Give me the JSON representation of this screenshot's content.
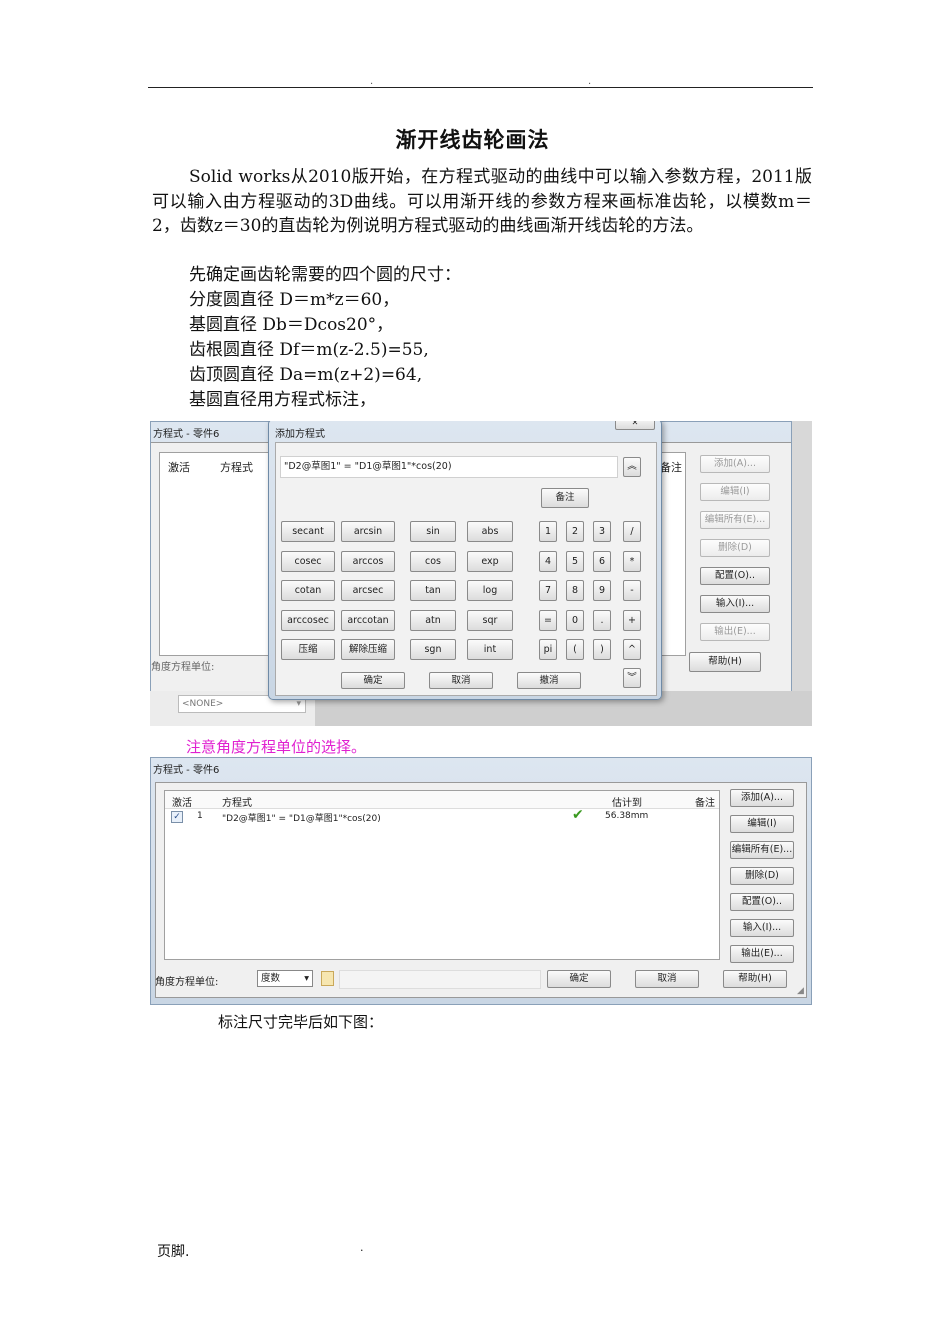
{
  "header": {
    "dot_left": ".",
    "dot_right": "."
  },
  "title": "渐开线齿轮画法",
  "intro": "Solid works从2010版开始，在方程式驱动的曲线中可以输入参数方程，2011版可以输入由方程驱动的3D曲线。可以用渐开线的参数方程来画标准齿轮，以模数m＝2，齿数z＝30的直齿轮为例说明方程式驱动的曲线画渐开线齿轮的方法。",
  "lines": [
    "先确定画齿轮需要的四个圆的尺寸：",
    "分度圆直径 D＝m*z＝60，",
    "基圆直径 Db＝Dcos20°，",
    "齿根圆直径 Df＝m(z-2.5)=55,",
    "齿顶圆直径 Da=m(z+2)=64,",
    "基圆直径用方程式标注，"
  ],
  "screenshot1": {
    "back_window_title": "方程式 - 零件6",
    "back_columns": [
      "激活",
      "方程式",
      "备注"
    ],
    "back_buttons": [
      {
        "label": "添加(A)...",
        "enabled": false
      },
      {
        "label": "编辑(I)",
        "enabled": false
      },
      {
        "label": "编辑所有(E)...",
        "enabled": false
      },
      {
        "label": "删除(D)",
        "enabled": false
      },
      {
        "label": "配置(O)..",
        "enabled": true
      },
      {
        "label": "输入(I)...",
        "enabled": true
      },
      {
        "label": "输出(E)...",
        "enabled": false
      }
    ],
    "back_help": "帮助(H)",
    "back_angle_label": "角度方程单位:",
    "none_select": "<NONE>",
    "dialog_title": "添加方程式",
    "equation_value": "\"D2@草图1\" = \"D1@草图1\"*cos(20)",
    "collapse_icon": "double-chevron-up",
    "note_button": "备注",
    "func_rows": [
      [
        "secant",
        "arcsin",
        "sin",
        "abs"
      ],
      [
        "cosec",
        "arccos",
        "cos",
        "exp"
      ],
      [
        "cotan",
        "arcsec",
        "tan",
        "log"
      ],
      [
        "arccosec",
        "arccotan",
        "atn",
        "sqr"
      ],
      [
        "压缩",
        "解除压缩",
        "sgn",
        "int"
      ]
    ],
    "num_rows": [
      [
        "1",
        "2",
        "3",
        "/"
      ],
      [
        "4",
        "5",
        "6",
        "*"
      ],
      [
        "7",
        "8",
        "9",
        "-"
      ],
      [
        "=",
        "0",
        ".",
        "+"
      ],
      [
        "pi",
        "(",
        ")",
        "^"
      ]
    ],
    "ok": "确定",
    "cancel": "取消",
    "undo": "撤消",
    "expand_icon": "double-chevron-down"
  },
  "note": "注意角度方程单位的选择。",
  "screenshot2": {
    "window_title": "方程式 - 零件6",
    "columns": [
      "激活",
      "方程式",
      "估计到",
      "备注"
    ],
    "rows": [
      {
        "active": true,
        "index": "1",
        "equation": "\"D2@草图1\" = \"D1@草图1\"*cos(20)",
        "status": "ok",
        "value": "56.38mm",
        "note": ""
      }
    ],
    "buttons": [
      "添加(A)...",
      "编辑(I)",
      "编辑所有(E)...",
      "删除(D)",
      "配置(O)..",
      "输入(I)...",
      "输出(E)..."
    ],
    "angle_label": "角度方程单位:",
    "angle_unit": "度数",
    "ok": "确定",
    "cancel": "取消",
    "help": "帮助(H)"
  },
  "caption": "标注尺寸完毕后如下图：",
  "footer": {
    "label": "页脚.",
    "dot": "."
  }
}
